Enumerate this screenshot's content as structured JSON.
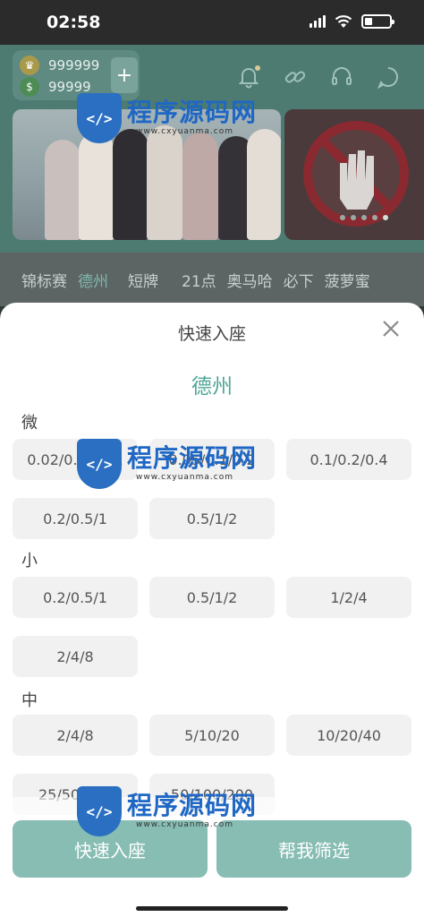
{
  "status_bar": {
    "time": "02:58"
  },
  "header": {
    "gold_coins": "999999",
    "silver_coins": "99999",
    "plus_label": "+"
  },
  "tabs": [
    {
      "label": "锦标赛",
      "active": false
    },
    {
      "label": "德州",
      "active": true
    },
    {
      "label": "短牌",
      "active": false
    },
    {
      "label": "21点",
      "active": false
    },
    {
      "label": "奥马哈",
      "active": false
    },
    {
      "label": "必下",
      "active": false
    },
    {
      "label": "菠萝蜜",
      "active": false
    }
  ],
  "sheet": {
    "title": "快速入座",
    "game_name": "德州",
    "groups": [
      {
        "label": "微",
        "stakes": [
          "0.02/0.05/0.1",
          "0.05/0.1/0.2",
          "0.1/0.2/0.4",
          "0.2/0.5/1",
          "0.5/1/2"
        ]
      },
      {
        "label": "小",
        "stakes": [
          "0.2/0.5/1",
          "0.5/1/2",
          "1/2/4",
          "2/4/8"
        ]
      },
      {
        "label": "中",
        "stakes": [
          "2/4/8",
          "5/10/20",
          "10/20/40",
          "25/50/100",
          "50/100/200"
        ]
      }
    ],
    "quick_seat_button": "快速入座",
    "filter_button": "帮我筛选"
  },
  "watermark": {
    "brand": "程序源码网",
    "url": "www.cxyuanma.com"
  },
  "colors": {
    "accent": "#5fa79a",
    "header_bg": "#4d7b72"
  }
}
